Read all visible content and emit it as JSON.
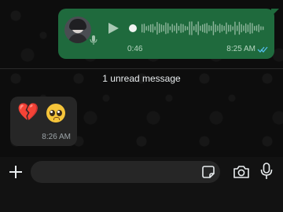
{
  "voice_message": {
    "duration": "0:46",
    "time": "8:25 AM",
    "read_status": "read",
    "bubble_color": "#1f6a3d",
    "tick_color": "#53bdeb",
    "progress": 0
  },
  "unread_banner": {
    "text": "1 unread message"
  },
  "incoming_message": {
    "emojis": [
      "💔"
    ],
    "time": "8:26 AM",
    "bubble_color": "#262626"
  },
  "composer": {
    "placeholder": ""
  }
}
